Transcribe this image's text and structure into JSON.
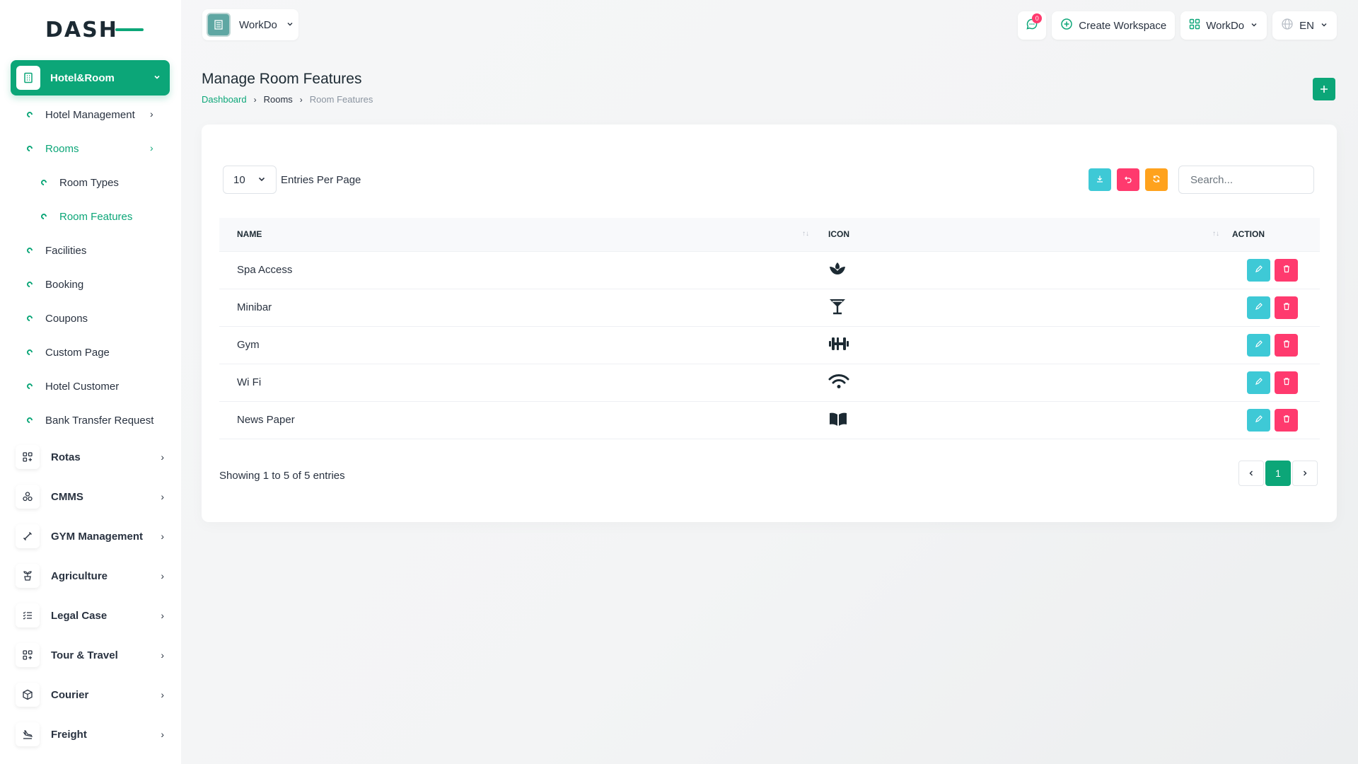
{
  "brand": {
    "logo_text": "DASH"
  },
  "sidebar": {
    "active_group": "Hotel&Room",
    "sub_items": [
      {
        "label": "Hotel Management",
        "has_chevron": true
      },
      {
        "label": "Rooms",
        "has_chevron": true
      },
      {
        "label": "Room Types"
      },
      {
        "label": "Room Features"
      },
      {
        "label": "Facilities"
      },
      {
        "label": "Booking"
      },
      {
        "label": "Coupons"
      },
      {
        "label": "Custom Page"
      },
      {
        "label": "Hotel Customer"
      },
      {
        "label": "Bank Transfer Request"
      }
    ],
    "groups": [
      {
        "label": "Rotas",
        "icon": "grid-plus-icon"
      },
      {
        "label": "CMMS",
        "icon": "shapes-icon"
      },
      {
        "label": "GYM Management",
        "icon": "dumbbell-icon"
      },
      {
        "label": "Agriculture",
        "icon": "plant-icon"
      },
      {
        "label": "Legal Case",
        "icon": "list-check-icon"
      },
      {
        "label": "Tour & Travel",
        "icon": "grid-plus-icon"
      },
      {
        "label": "Courier",
        "icon": "box-icon"
      },
      {
        "label": "Freight",
        "icon": "plane-landing-icon"
      }
    ]
  },
  "topbar": {
    "workspace": "WorkDo",
    "messages_badge": "0",
    "create_workspace": "Create Workspace",
    "workspace_menu": "WorkDo",
    "language": "EN"
  },
  "page": {
    "title": "Manage Room Features",
    "breadcrumb": [
      "Dashboard",
      "Rooms",
      "Room Features"
    ]
  },
  "table_controls": {
    "entries_value": "10",
    "entries_label": "Entries Per Page",
    "search_placeholder": "Search..."
  },
  "table": {
    "headers": [
      "NAME",
      "ICON",
      "ACTION"
    ],
    "rows": [
      {
        "name": "Spa Access",
        "icon": "spa-icon"
      },
      {
        "name": "Minibar",
        "icon": "martini-glass-icon"
      },
      {
        "name": "Gym",
        "icon": "dumbbell-icon"
      },
      {
        "name": "Wi Fi",
        "icon": "wifi-icon"
      },
      {
        "name": "News Paper",
        "icon": "book-open-icon"
      }
    ]
  },
  "footer": {
    "showing": "Showing 1 to 5 of 5 entries",
    "current_page": "1"
  },
  "colors": {
    "primary": "#0ca678",
    "edit": "#3ec9d6",
    "delete": "#ff3a6e",
    "warning": "#ffa21d"
  }
}
